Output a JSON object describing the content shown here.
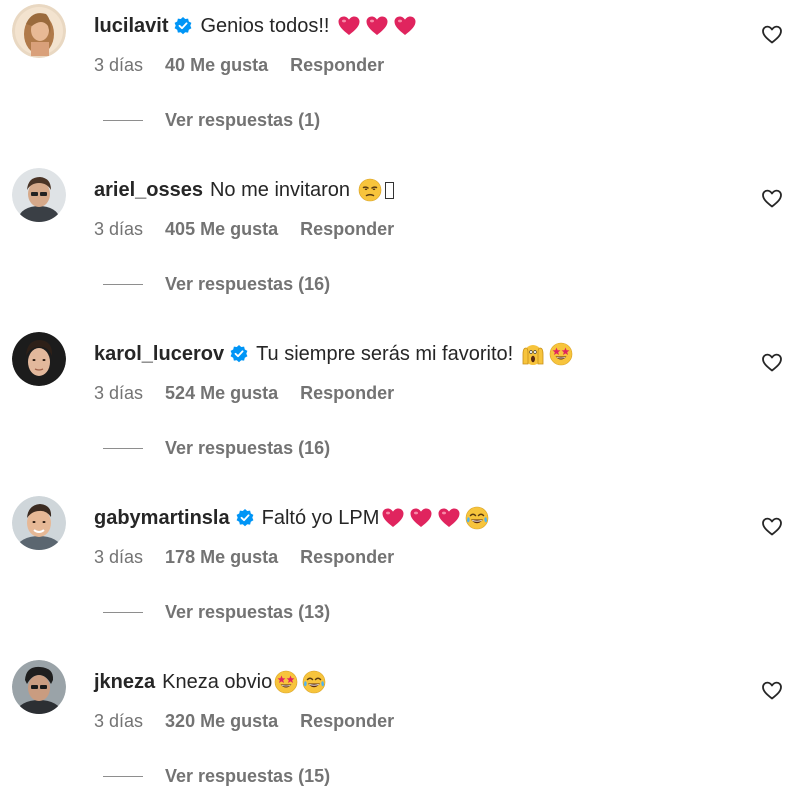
{
  "comments": [
    {
      "username": "lucilavit",
      "verified": true,
      "text": "Genios todos!!",
      "emojis": [
        "red-heart",
        "red-heart",
        "red-heart"
      ],
      "time": "3 días",
      "likes": "40 Me gusta",
      "reply": "Responder",
      "view_replies": "Ver respuestas (1)"
    },
    {
      "username": "ariel_osses",
      "verified": false,
      "text": "No me invitaron",
      "emojis": [
        "unamused-face",
        "missing-glyph"
      ],
      "time": "3 días",
      "likes": "405 Me gusta",
      "reply": "Responder",
      "view_replies": "Ver respuestas (16)"
    },
    {
      "username": "karol_lucerov",
      "verified": true,
      "text": "Tu siempre serás mi favorito!",
      "emojis": [
        "screaming-face",
        "star-struck"
      ],
      "time": "3 días",
      "likes": "524 Me gusta",
      "reply": "Responder",
      "view_replies": "Ver respuestas (16)"
    },
    {
      "username": "gabymartinsla",
      "verified": true,
      "text": "Faltó yo LPM",
      "emojis": [
        "red-heart",
        "red-heart",
        "red-heart",
        "tears-of-joy"
      ],
      "time": "3 días",
      "likes": "178 Me gusta",
      "reply": "Responder",
      "view_replies": "Ver respuestas (13)"
    },
    {
      "username": "jkneza",
      "verified": false,
      "text": "Kneza obvio",
      "emojis": [
        "star-struck",
        "tears-of-joy"
      ],
      "time": "3 días",
      "likes": "320 Me gusta",
      "reply": "Responder",
      "view_replies": "Ver respuestas (15)"
    }
  ],
  "icons": {
    "like": "heart-outline-icon",
    "verified": "verified-badge-icon"
  },
  "colors": {
    "text": "#262626",
    "secondary": "#737373",
    "verified_blue": "#0095f6",
    "heart_red": "#e0245e"
  }
}
